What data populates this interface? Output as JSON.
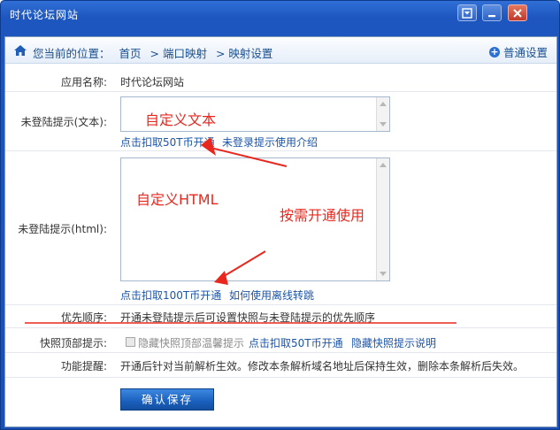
{
  "window": {
    "title": "时代论坛网站",
    "btn_dropdown": "dropdown-icon",
    "btn_minimize": "minimize-icon",
    "btn_close": "close-icon"
  },
  "breadcrumb": {
    "prefix": "您当前的位置：",
    "home": "首页",
    "port_mapping": "> 端口映射",
    "mapping_settings": "> 映射设置",
    "normal_settings": "普通设置"
  },
  "form": {
    "app_name_label": "应用名称:",
    "app_name_value": "时代论坛网站",
    "text_tip_label": "未登陆提示(文本):",
    "text_tip_link1": "点击扣取50T币开通",
    "text_tip_link2": "未登录提示使用介绍",
    "html_tip_label": "未登陆提示(html):",
    "html_tip_link1": "点击扣取100T币开通",
    "html_tip_link2": "如何使用离线转跳",
    "priority_label": "优先顺序:",
    "priority_value": "开通未登陆提示后可设置快照与未登陆提示的优先顺序",
    "snapshot_label": "快照顶部提示:",
    "snapshot_checkbox_text": "隐藏快照顶部温馨提示",
    "snapshot_link1": "点击扣取50T币开通",
    "snapshot_link2": "隐藏快照提示说明",
    "reminder_label": "功能提醒:",
    "reminder_value": "开通后针对当前解析生效。修改本条解析域名地址后保持生效，删除本条解析后失效。",
    "save_button": "确认保存"
  },
  "annotations": {
    "custom_text": "自定义文本",
    "custom_html": "自定义HTML",
    "on_demand": "按需开通使用",
    "color": "#e8281f"
  }
}
